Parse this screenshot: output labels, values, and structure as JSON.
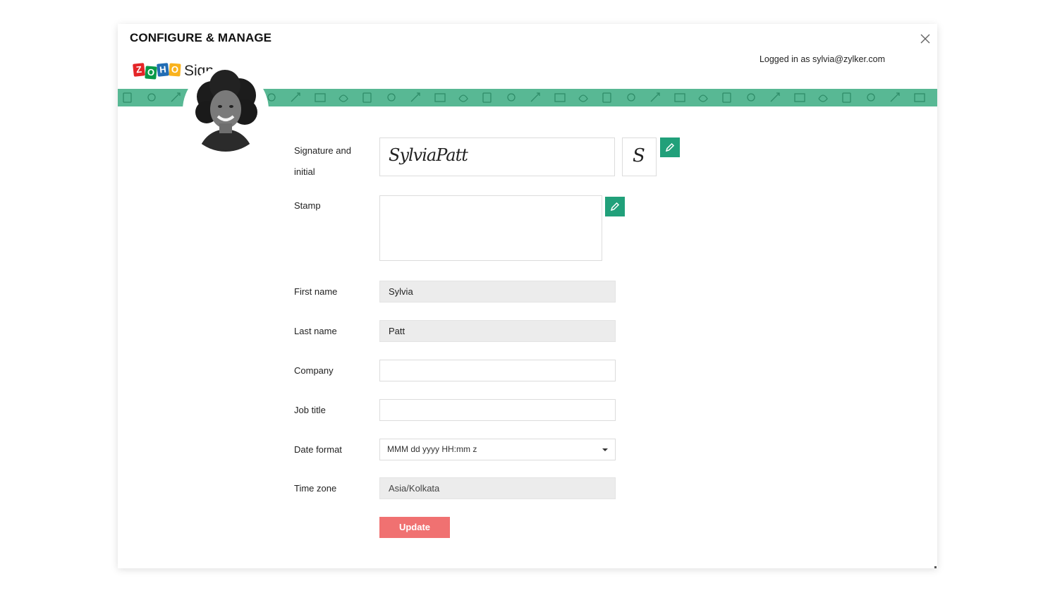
{
  "header": {
    "title": "CONFIGURE & MANAGE",
    "logged_in_text": "Logged in as sylvia@zylker.com"
  },
  "logo": {
    "letters": [
      "Z",
      "O",
      "H",
      "O"
    ],
    "letter_colors": [
      "#e42527",
      "#089949",
      "#226db4",
      "#f9b21d"
    ],
    "product": "Sign"
  },
  "banner": {
    "color": "#58b894",
    "pattern_icons": [
      "document-icon",
      "stamp-icon",
      "calendar-icon",
      "pen-icon",
      "key-icon"
    ]
  },
  "profile": {
    "avatar_icon": "user-photo"
  },
  "form": {
    "signature_label_line1": "Signature and",
    "signature_label_line2": "initial",
    "signature_text": "SylviaPatt",
    "initial_text": "S",
    "stamp_label": "Stamp",
    "first_name_label": "First name",
    "first_name_value": "Sylvia",
    "last_name_label": "Last name",
    "last_name_value": "Patt",
    "company_label": "Company",
    "company_value": "",
    "job_title_label": "Job title",
    "job_title_value": "",
    "date_format_label": "Date format",
    "date_format_value": "MMM dd yyyy HH:mm z",
    "time_zone_label": "Time zone",
    "time_zone_value": "Asia/Kolkata",
    "update_label": "Update"
  },
  "colors": {
    "accent": "#21a07a",
    "update_button": "#f07171",
    "readonly_field": "#ececec"
  }
}
